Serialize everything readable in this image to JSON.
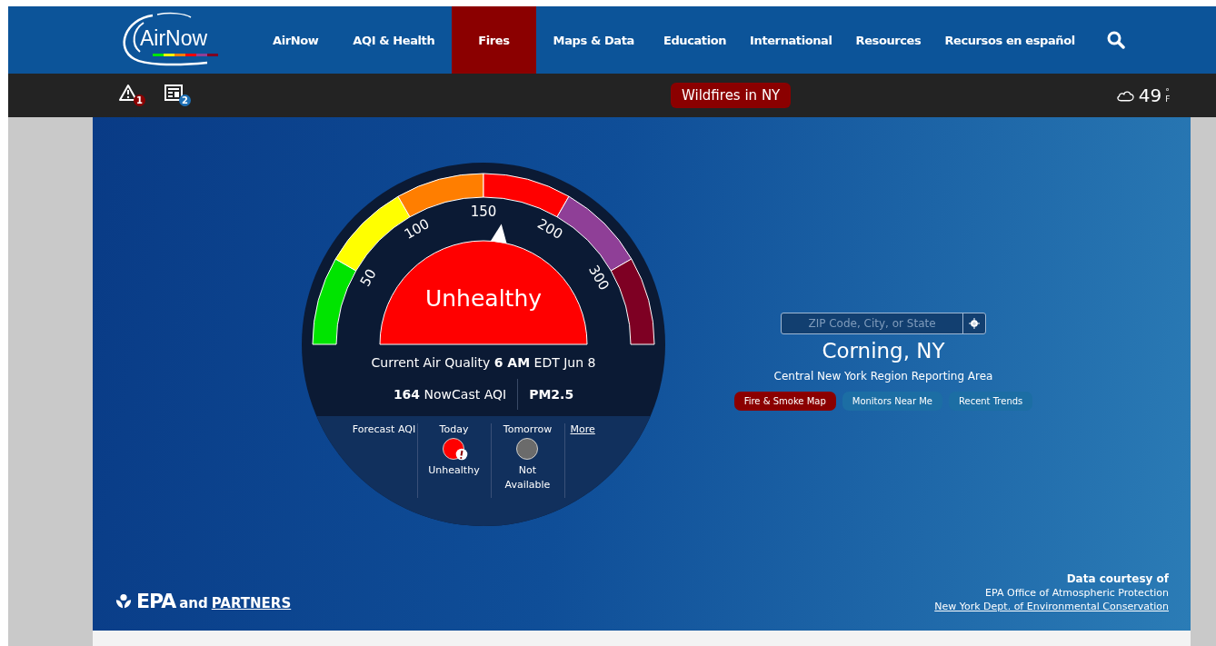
{
  "nav": {
    "logo": "AirNow",
    "items": [
      {
        "label": "AirNow",
        "selected": false
      },
      {
        "label": "AQI & Health",
        "selected": false
      },
      {
        "label": "Fires",
        "selected": true
      },
      {
        "label": "Maps & Data",
        "selected": false
      },
      {
        "label": "Education",
        "selected": false
      },
      {
        "label": "International",
        "selected": false
      },
      {
        "label": "Resources",
        "selected": false
      },
      {
        "label": "Recursos en español",
        "selected": false
      }
    ]
  },
  "subbar": {
    "alerts_count": "1",
    "news_count": "2",
    "banner": "Wildfires in NY",
    "temperature": "49",
    "unit": "°F"
  },
  "gauge": {
    "segments": [
      {
        "color": "#00e400"
      },
      {
        "color": "#ffff00"
      },
      {
        "color": "#ff7e00"
      },
      {
        "color": "#ff0000"
      },
      {
        "color": "#8f3f97"
      },
      {
        "color": "#7e0023"
      }
    ],
    "ticks": [
      "50",
      "100",
      "150",
      "200",
      "300"
    ],
    "level": 0.547,
    "dial": {
      "label": "Unhealthy",
      "color": "#ff0000"
    },
    "current": "Current Air Quality **6 AM** EDT Jun 8",
    "aqi": "**164** NowCast AQI",
    "pollutant": "PM2.5",
    "forecast_label": "Forecast AQI",
    "forecast": [
      {
        "day": "Today",
        "status": "Unhealthy",
        "color": "#ff0000",
        "alert": true
      },
      {
        "day": "Tomorrow",
        "status": "Not Available",
        "color": "#6b6b6b",
        "alert": false
      }
    ],
    "more": "More"
  },
  "location": {
    "placeholder": "ZIP Code, City, or State",
    "city": "Corning, NY",
    "area": "Central New York Region Reporting Area",
    "buttons": [
      {
        "label": "Fire & Smoke Map",
        "color": "#8b0000"
      },
      {
        "label": "Monitors Near Me",
        "color": "#1c6ea4"
      },
      {
        "label": "Recent Trends",
        "color": "#1c6ea4"
      }
    ]
  },
  "footer": {
    "logo": "EPA",
    "and": "and",
    "partners": "PARTNERS",
    "courtesy": "Data courtesy of",
    "source": "EPA Office of Atmospheric Protection",
    "link": "New York Dept. of Environmental Conservation"
  }
}
